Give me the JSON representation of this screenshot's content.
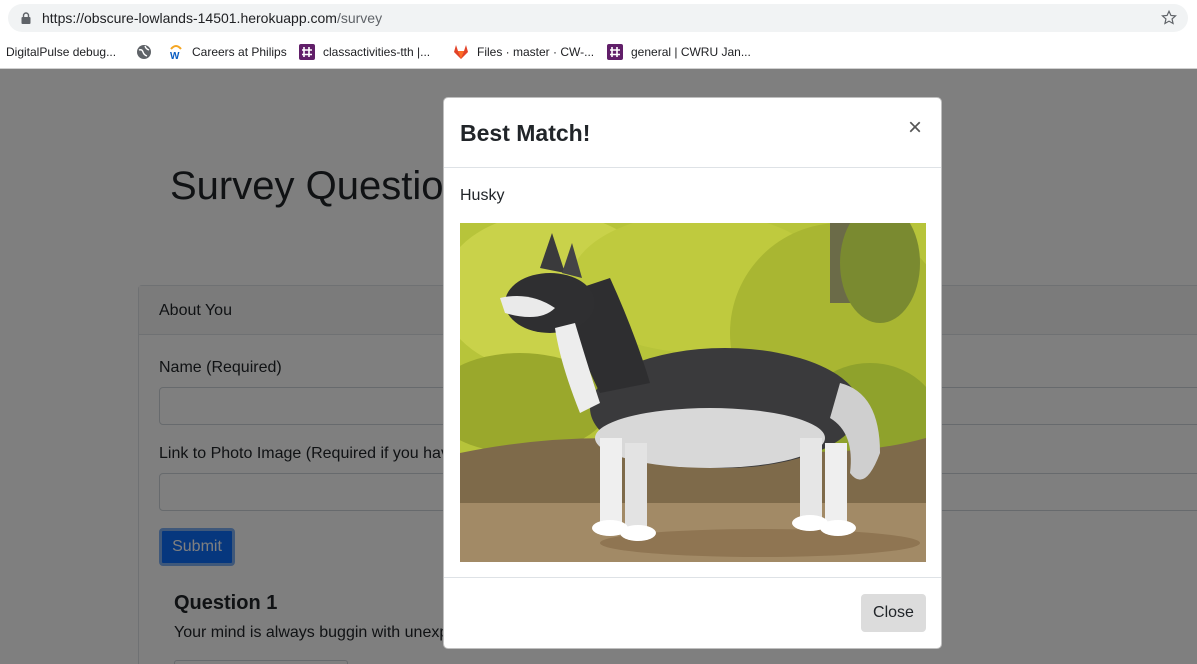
{
  "browser": {
    "url_host": "https://obscure-lowlands-14501.herokuapp.com",
    "url_path": "/survey",
    "bookmarks": [
      {
        "label": "DigitalPulse debug...",
        "icon": "none"
      },
      {
        "label": "",
        "icon": "globe-icon"
      },
      {
        "label": "Careers at Philips",
        "icon": "workday-icon"
      },
      {
        "label": "classactivities-tth |...",
        "icon": "slack-icon"
      },
      {
        "label": "Files · master · CW-...",
        "icon": "gitlab-icon"
      },
      {
        "label": "general | CWRU Jan...",
        "icon": "slack-icon"
      }
    ]
  },
  "page": {
    "title": "Survey Questions",
    "card_header": "About You",
    "name_label": "Name (Required)",
    "photo_label": "Link to Photo Image (Required if you have",
    "submit_label": "Submit",
    "question_title": "Question 1",
    "question_text": "Your mind is always buggin with unexp"
  },
  "modal": {
    "title": "Best Match!",
    "close_symbol": "×",
    "match_name": "Husky",
    "close_button": "Close"
  },
  "colors": {
    "primary": "#0d6efd",
    "backdrop": "rgba(0,0,0,0.5)"
  }
}
